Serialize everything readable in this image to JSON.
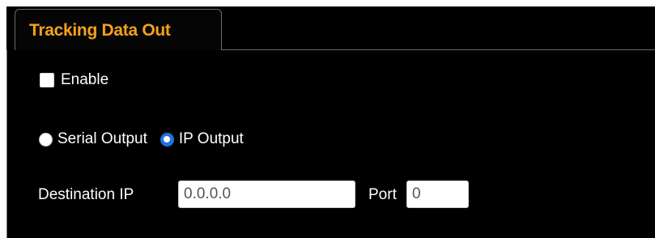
{
  "tab": {
    "label": "Tracking Data Out"
  },
  "enable": {
    "label": "Enable",
    "checked": false
  },
  "output_mode": {
    "options": [
      {
        "label": "Serial Output",
        "selected": false
      },
      {
        "label": "IP Output",
        "selected": true
      }
    ]
  },
  "destination": {
    "ip_label": "Destination IP",
    "ip_value": "0.0.0.0",
    "port_label": "Port",
    "port_value": "0"
  },
  "colors": {
    "background": "#000000",
    "tab_text": "#f5a218",
    "radio_selected": "#1f73e0",
    "border": "#6a6a6a"
  }
}
